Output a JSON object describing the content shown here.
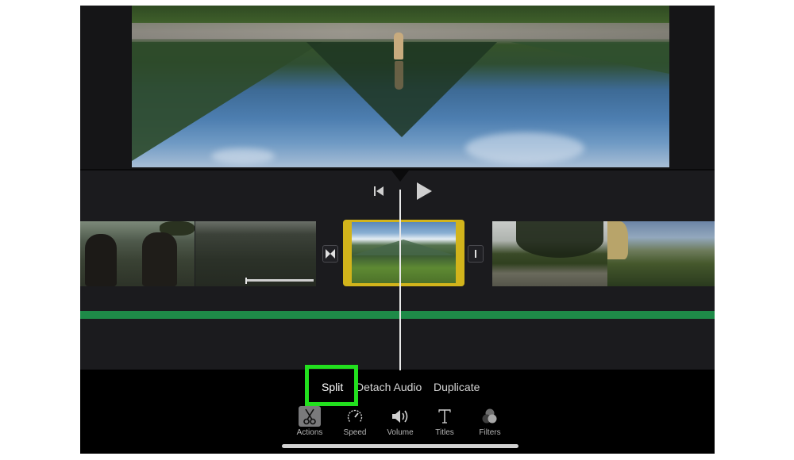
{
  "viewer": {
    "description": "Video preview: person standing in lake with mountain reflection"
  },
  "playback": {
    "skip_back_icon": "skip-to-start-icon",
    "play_icon": "play-icon"
  },
  "timeline": {
    "clips": [
      {
        "name": "hikers-clip",
        "selected": false
      },
      {
        "name": "forest-clip",
        "selected": false
      },
      {
        "name": "mountain-valley-clip",
        "selected": true
      },
      {
        "name": "field-tree-clip",
        "selected": false
      },
      {
        "name": "cliff-clip",
        "selected": false
      }
    ],
    "transitions": [
      {
        "icon": "cross-dissolve-transition-icon"
      },
      {
        "icon": "no-transition-icon"
      }
    ],
    "colors": {
      "selected_clip": "#d2b41b",
      "audio_track": "#1e8a48",
      "highlight": "#22e01e"
    }
  },
  "actions": {
    "split": "Split",
    "detach_audio": "Detach Audio",
    "duplicate": "Duplicate"
  },
  "tabs": [
    {
      "label": "Actions",
      "icon": "scissors-icon",
      "active": true
    },
    {
      "label": "Speed",
      "icon": "speedometer-icon",
      "active": false
    },
    {
      "label": "Volume",
      "icon": "speaker-icon",
      "active": false
    },
    {
      "label": "Titles",
      "icon": "text-t-icon",
      "active": false
    },
    {
      "label": "Filters",
      "icon": "filters-circles-icon",
      "active": false
    }
  ]
}
